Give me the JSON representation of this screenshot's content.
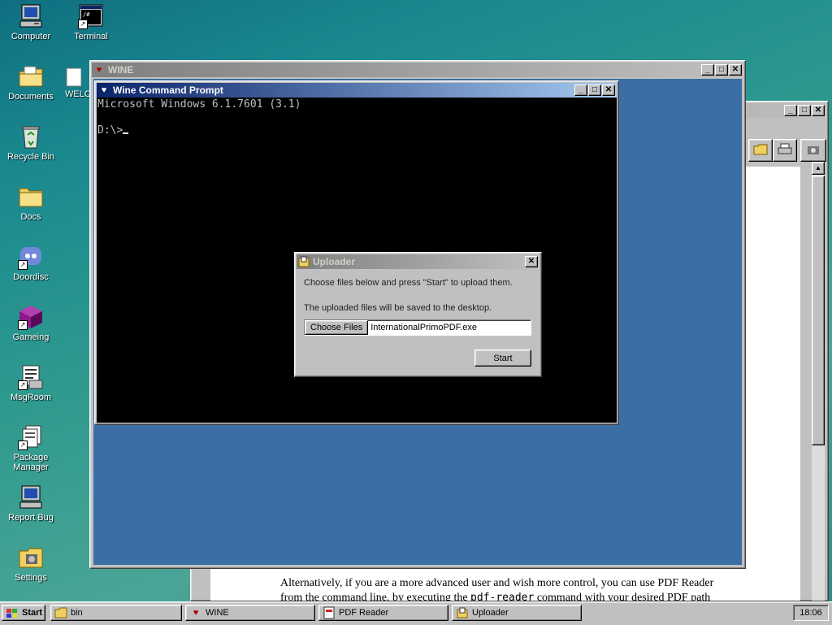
{
  "desktop": {
    "icons": [
      {
        "label": "Computer"
      },
      {
        "label": "Terminal"
      },
      {
        "label": "Documents"
      },
      {
        "label": "WELC"
      },
      {
        "label": "Recycle Bin"
      },
      {
        "label": "Docs"
      },
      {
        "label": "Doordisc"
      },
      {
        "label": "Gameing"
      },
      {
        "label": "MsgRoom"
      },
      {
        "label": "Package Manager"
      },
      {
        "label": "Report Bug"
      },
      {
        "label": "Settings"
      }
    ]
  },
  "wine_window": {
    "title": "WINE"
  },
  "cmd_window": {
    "title": "Wine Command Prompt",
    "line1": "Microsoft Windows 6.1.7601 (3.1)",
    "prompt": "D:\\>"
  },
  "pdf_window": {
    "text_line1": "Alternatively, if you are a more advanced user and wish more control, you can use PDF Reader",
    "text_line2_pre": "from the command line, by executing the ",
    "text_line2_code": "pdf-reader",
    "text_line2_post": " command with your desired PDF path"
  },
  "uploader": {
    "title": "Uploader",
    "instructions": "Choose files below and press \"Start\" to upload them.",
    "note": "The uploaded files will be saved to the desktop.",
    "choose_label": "Choose Files",
    "file_name": "InternationalPrimoPDF.exe",
    "start_label": "Start"
  },
  "taskbar": {
    "start_label": "Start",
    "tasks": [
      {
        "label": "bin"
      },
      {
        "label": "WINE"
      },
      {
        "label": "PDF Reader"
      },
      {
        "label": "Uploader"
      }
    ],
    "clock": "18:06"
  },
  "colors": {
    "title_active": "#0a246a",
    "wine_client": "#3a6ea5",
    "console_bg": "#000000"
  }
}
